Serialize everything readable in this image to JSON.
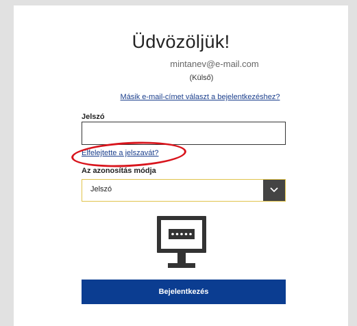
{
  "header": {
    "title": "Üdvözöljük!",
    "email": "mintanev@e-mail.com",
    "account_type": "(Külső)"
  },
  "links": {
    "other_email": "Másik e-mail-címet választ a bejelentkezéshez?",
    "forgot_password": "Elfelejtette a jelszavát?"
  },
  "password": {
    "label": "Jelszó",
    "value": ""
  },
  "auth_method": {
    "label": "Az azonosítás módja",
    "selected": "Jelszó"
  },
  "icons": {
    "monitor": "password-monitor-icon",
    "dropdown": "chevron-down-icon"
  },
  "actions": {
    "login_label": "Bejelentkezés"
  },
  "colors": {
    "primary": "#0b3d91",
    "link": "#1a3e8c",
    "highlight": "#d8141c",
    "select_border": "#e0c34a",
    "monitor": "#333333"
  }
}
